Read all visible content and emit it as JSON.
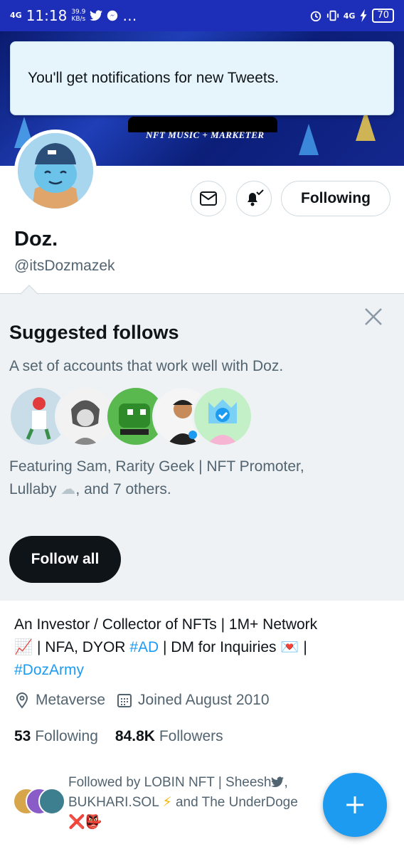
{
  "status_bar": {
    "network": "4G",
    "time": "11:18",
    "speed_value": "39.9",
    "speed_unit": "KB/s",
    "more": "…",
    "network_right": "4G",
    "battery": "70"
  },
  "banner": {
    "logo_text": "NFT MUSIC + MARKETER"
  },
  "toast": {
    "message": "You'll get notifications for new Tweets."
  },
  "profile": {
    "actions": {
      "follow_label": "Following"
    },
    "name": "Doz.",
    "handle": "@itsDozmazek"
  },
  "suggested": {
    "title": "Suggested follows",
    "subtitle": "A set of accounts that work well with Doz.",
    "featuring_line1": "Featuring Sam, Rarity Geek | NFT Promoter,",
    "featuring_line2_a": "Lullaby",
    "featuring_line2_emoji": "☁",
    "featuring_line2_b": ", and 7 others.",
    "follow_all_label": "Follow all"
  },
  "bio": {
    "line1": "An Investor / Collector of NFTs | 1M+ Network",
    "emoji_chart": "📈",
    "line2_a": " | NFA, DYOR ",
    "hashtag_ad": "#AD",
    "line2_b": " | DM for Inquiries ",
    "emoji_letter": "💌",
    "line2_c": " |",
    "hashtag_army": "#DozArmy",
    "location": "Metaverse",
    "joined": "Joined August 2010",
    "following_count": "53",
    "following_label": "Following",
    "followers_count": "84.8K",
    "followers_label": "Followers"
  },
  "followed_by": {
    "line1": "Followed by LOBIN NFT | Sheesh",
    "line1_suffix": ",",
    "line2_a": "BUKHARI.SOL",
    "line2_emoji": "⚡",
    "line2_b": " and The UnderDoge",
    "line3": "❌👺"
  },
  "colors": {
    "accent": "#1d9bf0",
    "status_bar": "#1d2fb8",
    "suggest_bg": "#eef2f4"
  }
}
